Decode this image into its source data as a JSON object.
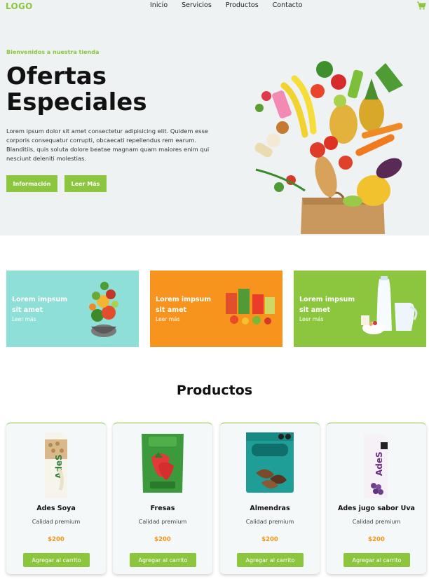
{
  "nav": {
    "logo": "LOGO",
    "links": [
      "Inicio",
      "Servicios",
      "Productos",
      "Contacto"
    ],
    "cart_icon": "cart-icon"
  },
  "hero": {
    "welcome": "Bienvenidos a nuestra tienda",
    "title_line1": "Ofertas",
    "title_line2": "Especiales",
    "description": "Lorem ipsum dolor sit amet consectetur adipisicing elit. Quidem esse corporis consequatur corrupti, obcaecati repellendus rem earum. Blanditiis, quis soluta dolore beatae magnam quam maiores enim qui nesciunt deleniti molestias.",
    "btn_info": "Información",
    "btn_more": "Leer Más"
  },
  "promos": [
    {
      "title": "Lorem impsum sit amet",
      "link": "Leer más",
      "color": "#8ddfd8"
    },
    {
      "title": "Lorem impsum sit amet",
      "link": "Leer más",
      "color": "#f7941d"
    },
    {
      "title": "Lorem impsum sit amet",
      "link": "Leer más",
      "color": "#8cc63f"
    }
  ],
  "products_title": "Productos",
  "products": [
    {
      "name": "Ades Soya",
      "desc": "Calidad premium",
      "price": "$200",
      "button": "Agregar al carrito"
    },
    {
      "name": "Fresas",
      "desc": "Calidad premium",
      "price": "$200",
      "button": "Agregar al carrito"
    },
    {
      "name": "Almendras",
      "desc": "Calidad premium",
      "price": "$200",
      "button": "Agregar al carrito"
    },
    {
      "name": "Ades jugo sabor Uva",
      "desc": "Calidad premium",
      "price": "$200",
      "button": "Agregar al carrito"
    }
  ],
  "colors": {
    "accent": "#8cc63f",
    "price": "#f7941d",
    "teal": "#8ddfd8"
  }
}
